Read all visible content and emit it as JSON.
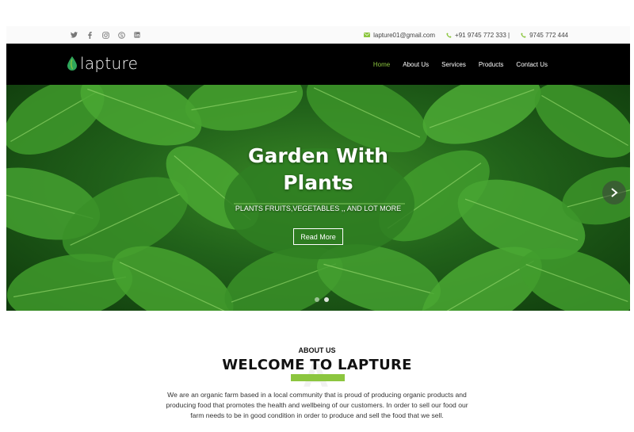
{
  "topbar": {
    "socials": [
      "twitter-icon",
      "facebook-icon",
      "instagram-icon",
      "skype-icon",
      "linkedin-icon"
    ],
    "email": "lapture01@gmail.com",
    "phone1": "+91 9745 772 333 |",
    "phone2": "9745 772 444"
  },
  "brand": {
    "name": "lapture",
    "accent": "#8cc63f",
    "logo_color": "#2fa65a"
  },
  "nav": {
    "items": [
      {
        "label": "Home",
        "active": true
      },
      {
        "label": "About Us"
      },
      {
        "label": "Services"
      },
      {
        "label": "Products"
      },
      {
        "label": "Contact Us"
      }
    ]
  },
  "hero": {
    "title_line1": "Garden With",
    "title_line2": "Plants",
    "subtitle": "PLANTS FRUITS,VEGETABLES ,, AND LOT MORE",
    "button_label": "Read More",
    "slides": 2,
    "active_slide": 1
  },
  "about": {
    "label": "ABOUT US",
    "title": "WELCOME TO LAPTURE",
    "watermark": "A",
    "text": "We are an organic farm based in a local community that is proud of producing organic products and producing food that promotes the health and wellbeing of our customers. In order to sell our food our farm needs to be in good condition in order to produce and sell the food that we sell."
  }
}
